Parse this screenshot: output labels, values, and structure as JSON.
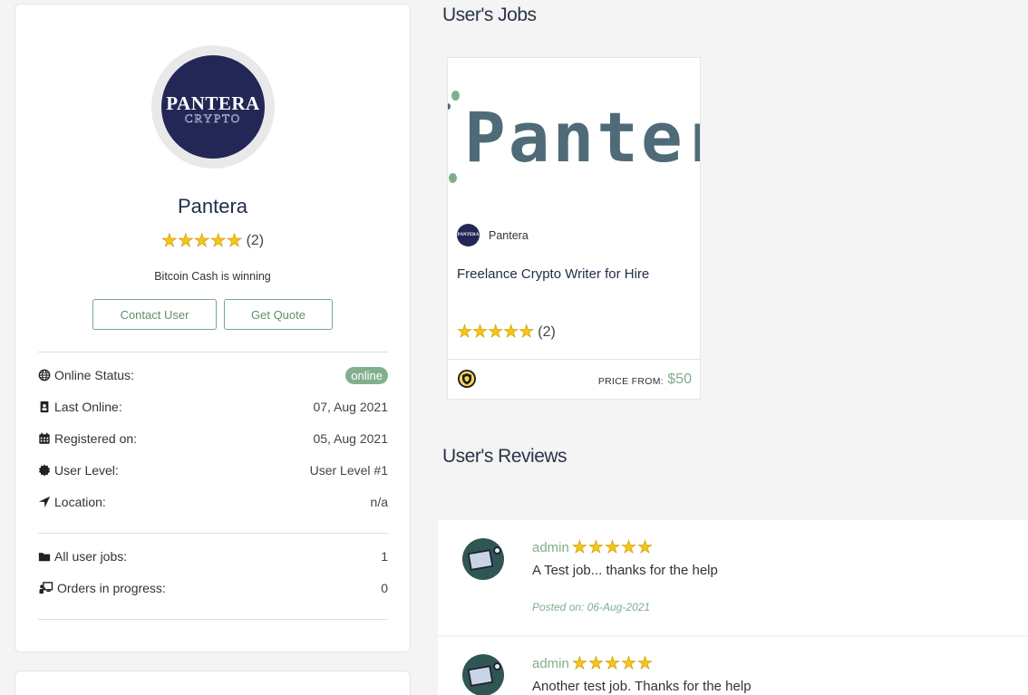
{
  "profile": {
    "logo_main": "PANTERA",
    "logo_sub": "CRYPTO",
    "name": "Pantera",
    "rating_count": "(2)",
    "stars": 5,
    "tagline": "Bitcoin Cash is winning",
    "contact_button": "Contact User",
    "quote_button": "Get Quote",
    "details": [
      {
        "label": "Online Status:",
        "value": "online",
        "icon": "globe-icon"
      },
      {
        "label": "Last Online:",
        "value": "07, Aug 2021",
        "icon": "id-card-icon"
      },
      {
        "label": "Registered on:",
        "value": "05, Aug 2021",
        "icon": "calendar-icon"
      },
      {
        "label": "User Level:",
        "value": "User Level #1",
        "icon": "badge-icon"
      },
      {
        "label": "Location:",
        "value": "n/a",
        "icon": "location-arrow-icon"
      }
    ],
    "stats": [
      {
        "label": "All user jobs:",
        "value": "1",
        "icon": "folder-icon"
      },
      {
        "label": "Orders in progress:",
        "value": "0",
        "icon": "person-chalkboard-icon"
      }
    ]
  },
  "jobs_section": {
    "title": "User's Jobs",
    "job": {
      "image_text": "Pantera",
      "seller": "Pantera",
      "title": "Freelance Crypto Writer for Hire",
      "rating_count": "(2)",
      "stars": 5,
      "price_label": "PRICE FROM:",
      "price": "$50",
      "seller_badge_icon": "shield-badge-icon"
    }
  },
  "reviews_section": {
    "title": "User's Reviews",
    "reviews": [
      {
        "reviewer": "admin",
        "stars": 5,
        "text": "A Test job... thanks for the help",
        "date": "Posted on: 06-Aug-2021"
      },
      {
        "reviewer": "admin",
        "stars": 5,
        "text": "Another test job. Thanks for the help"
      }
    ]
  },
  "colors": {
    "accent_green": "#7fae8c",
    "navy": "#232755",
    "star_yellow": "#f5c518"
  }
}
